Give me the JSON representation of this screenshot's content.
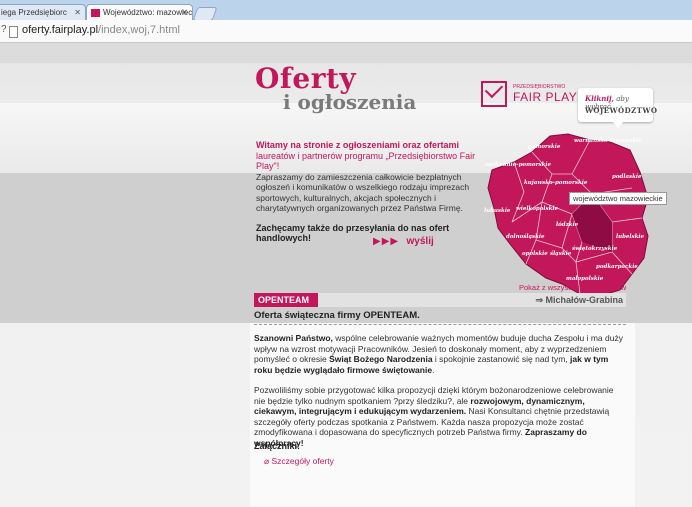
{
  "browser": {
    "tabs": [
      {
        "label": "iega Przedsiębiorc"
      },
      {
        "label": "Województwo: mazowieck"
      }
    ],
    "url_host": "oferty.fairplay.pl",
    "url_path": "/index,woj,7.html"
  },
  "header": {
    "title_line1": "Oferty",
    "title_line2": "i ogłoszenia",
    "brand_small": "PRZEDSIĘBIORSTWO",
    "brand_big": "FAIR PLAY",
    "callout_line1_em": "Kliknij,",
    "callout_line1": "aby wybrać",
    "callout_line2": "WOJEWÓDZTWO"
  },
  "intro": {
    "heading": "Witamy na stronie z ogłoszeniami oraz ofertami",
    "subheading": "laureatów i partnerów programu „Przedsiębiorstwo Fair Play\"!",
    "text": "Zapraszamy do zamieszczenia całkowicie bezpłatnych ogłoszeń i komunikatów o wszelkiego rodzaju imprezach sportowych, kulturalnych, akcjach społecznych i charytatywnych organizowanych przez Państwa Firmę.",
    "cta": "Zachęcamy także do przesyłania do nas ofert handlowych!",
    "send_arrows": "▶▶▶",
    "send_label": "wyślij"
  },
  "map": {
    "regions": [
      "pomorskie",
      "warmińsko-mazurskie",
      "zachodnio-pomorskie",
      "kujawsko-pomorskie",
      "podlaskie",
      "lubuskie",
      "wielkopolskie",
      "mazowieckie",
      "łódzkie",
      "dolnośląskie",
      "lubelskie",
      "opolskie",
      "śląskie",
      "świętokrzyskie",
      "podkarpackie",
      "małopolskie"
    ],
    "tooltip": "województwo mazowieckie",
    "fill": "#c2185b"
  },
  "offer": {
    "all_link": "Pokaż z wszystkich województw",
    "tag": "OPENTEAM",
    "location": "⇒ Michałów-Grabina",
    "title": "Oferta świąteczna  firmy OPENTEAM.",
    "p1_b1": "Szanowni Państwo,",
    "p1_t1": " wspólne celebrowanie ważnych momentów buduje ducha Zespołu i ma duży wpływ na wzrost motywacji Pracowników. Jesień to doskonały moment, aby z wyprzedzeniem pomyśleć o okresie ",
    "p1_b2": "Świąt Bożego Narodzenia",
    "p1_t2": " i spokojnie zastanowić się nad tym, ",
    "p1_b3": "jak w tym roku będzie wyglądało firmowe świętowanie",
    "p1_t3": ".",
    "p2_t1": "Pozwoliliśmy sobie przygotować kilka propozycji dzięki którym bożonarodzeniowe celebrowanie nie będzie tylko nudnym spotkaniem ?przy śledziku?, ale ",
    "p2_b1": "rozwojowym, dynamicznym, ciekawym, integrującym i edukującym wydarzeniem.",
    "p2_t2": " Nasi Konsultanci chętnie przedstawią szczegóły oferty podczas spotkania z Państwem. Każda nasza propozycja może zostać zmodyfikowana i dopasowana do specyficznych potrzeb Państwa firmy. ",
    "p2_b2": "Zapraszamy do współpracy!",
    "attachments_heading": "Załączniki:",
    "attachment_link": "Szczegóły oferty"
  },
  "colors": {
    "accent": "#c2185b"
  }
}
